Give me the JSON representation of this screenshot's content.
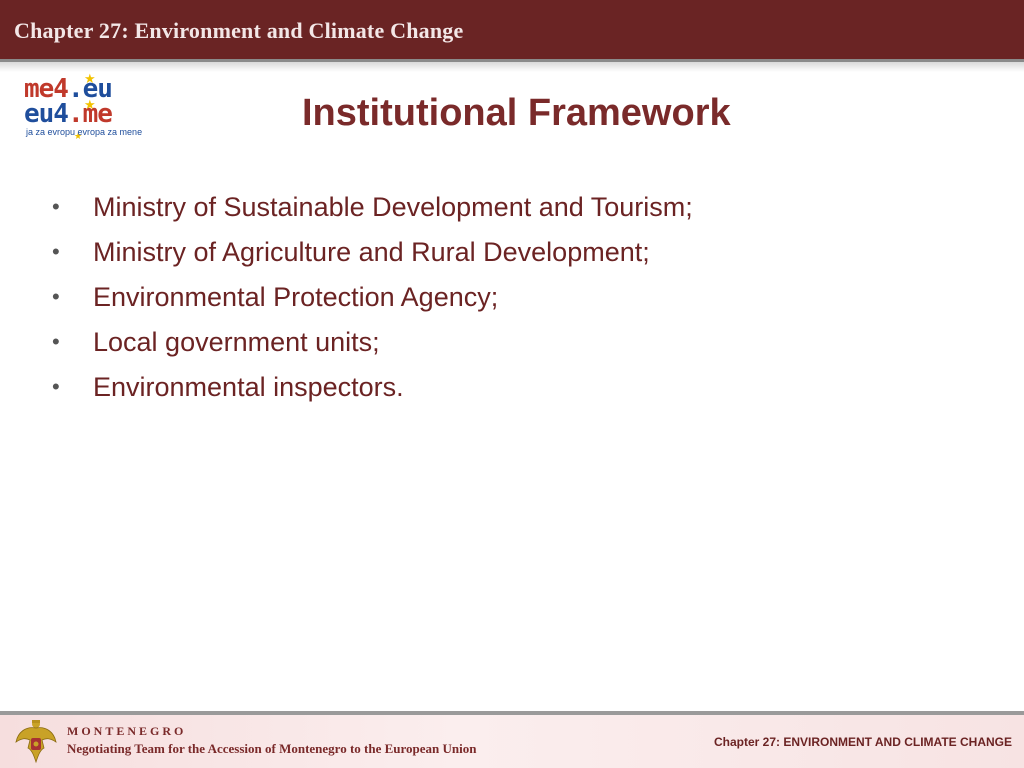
{
  "header": {
    "title": "Chapter 27: Environment and Climate Change"
  },
  "logo": {
    "line1_a": "me4",
    "line1_b": ".eu",
    "line2_a": "eu4",
    "line2_b": ".me",
    "tagline": "ja za evropu evropa za mene",
    "colors": {
      "red": "#c0392b",
      "blue": "#1f4e9c",
      "star": "#f2c200"
    }
  },
  "slide": {
    "title": "Institutional Framework",
    "bullets": [
      "Ministry of Sustainable Development and Tourism;",
      "Ministry of Agriculture and Rural Development;",
      "Environmental Protection Agency;",
      "Local government units;",
      "Environmental inspectors."
    ]
  },
  "footer": {
    "country": "MONTENEGRO",
    "team": "Negotiating Team for the Accession of  Montenegro to the European Union",
    "chapter": "Chapter 27:  ENVIRONMENT AND CLIMATE CHANGE",
    "emblem_icon": "coat-of-arms-icon"
  },
  "colors": {
    "header_bg": "#6a2424",
    "title": "#7a2a2a",
    "bullet_text": "#6b2323",
    "footer_bg": "#f6dede"
  }
}
